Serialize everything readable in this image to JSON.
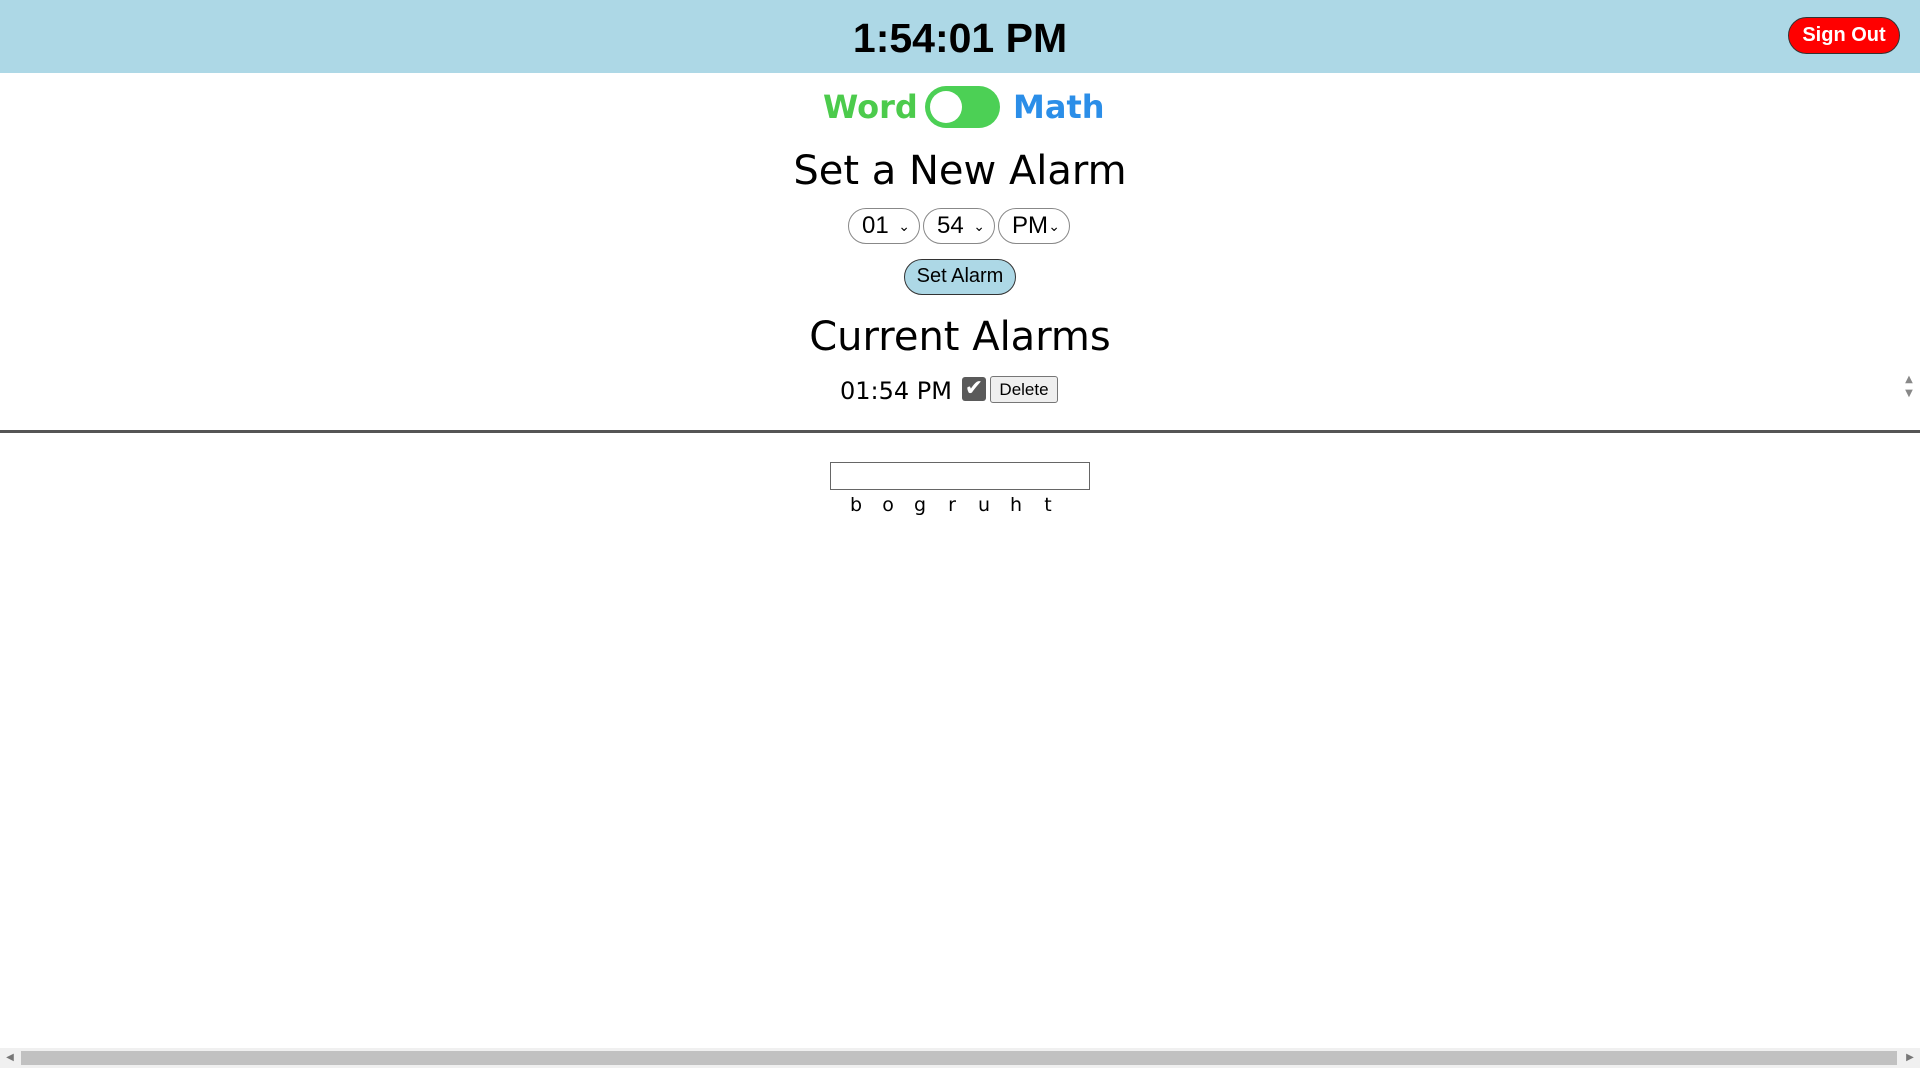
{
  "header": {
    "clock": "1:54:01 PM",
    "signout_label": "Sign Out"
  },
  "mode": {
    "left_label": "Word",
    "right_label": "Math"
  },
  "new_alarm": {
    "heading": "Set a New Alarm",
    "hour": "01",
    "minute": "54",
    "period": "PM",
    "button_label": "Set Alarm"
  },
  "current_alarms": {
    "heading": "Current Alarms",
    "items": [
      {
        "time": "01:54 PM",
        "enabled": true,
        "delete_label": "Delete"
      }
    ]
  },
  "puzzle": {
    "answer_value": "",
    "letters": [
      "b",
      "o",
      "g",
      "r",
      "u",
      "h",
      "t"
    ]
  },
  "colors": {
    "header_bg": "#add8e6",
    "signout_bg": "#ff0000",
    "word_color": "#4ccb4c",
    "math_color": "#2b8ee8",
    "toggle_bg": "#4cd055"
  }
}
